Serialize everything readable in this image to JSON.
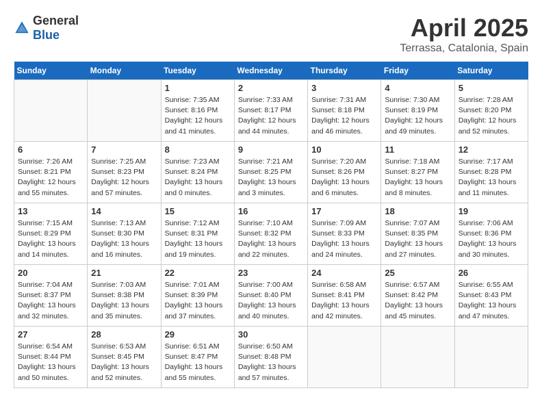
{
  "logo": {
    "general": "General",
    "blue": "Blue"
  },
  "header": {
    "month": "April 2025",
    "location": "Terrassa, Catalonia, Spain"
  },
  "weekdays": [
    "Sunday",
    "Monday",
    "Tuesday",
    "Wednesday",
    "Thursday",
    "Friday",
    "Saturday"
  ],
  "weeks": [
    [
      {
        "day": "",
        "info": ""
      },
      {
        "day": "",
        "info": ""
      },
      {
        "day": "1",
        "info": "Sunrise: 7:35 AM\nSunset: 8:16 PM\nDaylight: 12 hours\nand 41 minutes."
      },
      {
        "day": "2",
        "info": "Sunrise: 7:33 AM\nSunset: 8:17 PM\nDaylight: 12 hours\nand 44 minutes."
      },
      {
        "day": "3",
        "info": "Sunrise: 7:31 AM\nSunset: 8:18 PM\nDaylight: 12 hours\nand 46 minutes."
      },
      {
        "day": "4",
        "info": "Sunrise: 7:30 AM\nSunset: 8:19 PM\nDaylight: 12 hours\nand 49 minutes."
      },
      {
        "day": "5",
        "info": "Sunrise: 7:28 AM\nSunset: 8:20 PM\nDaylight: 12 hours\nand 52 minutes."
      }
    ],
    [
      {
        "day": "6",
        "info": "Sunrise: 7:26 AM\nSunset: 8:21 PM\nDaylight: 12 hours\nand 55 minutes."
      },
      {
        "day": "7",
        "info": "Sunrise: 7:25 AM\nSunset: 8:23 PM\nDaylight: 12 hours\nand 57 minutes."
      },
      {
        "day": "8",
        "info": "Sunrise: 7:23 AM\nSunset: 8:24 PM\nDaylight: 13 hours\nand 0 minutes."
      },
      {
        "day": "9",
        "info": "Sunrise: 7:21 AM\nSunset: 8:25 PM\nDaylight: 13 hours\nand 3 minutes."
      },
      {
        "day": "10",
        "info": "Sunrise: 7:20 AM\nSunset: 8:26 PM\nDaylight: 13 hours\nand 6 minutes."
      },
      {
        "day": "11",
        "info": "Sunrise: 7:18 AM\nSunset: 8:27 PM\nDaylight: 13 hours\nand 8 minutes."
      },
      {
        "day": "12",
        "info": "Sunrise: 7:17 AM\nSunset: 8:28 PM\nDaylight: 13 hours\nand 11 minutes."
      }
    ],
    [
      {
        "day": "13",
        "info": "Sunrise: 7:15 AM\nSunset: 8:29 PM\nDaylight: 13 hours\nand 14 minutes."
      },
      {
        "day": "14",
        "info": "Sunrise: 7:13 AM\nSunset: 8:30 PM\nDaylight: 13 hours\nand 16 minutes."
      },
      {
        "day": "15",
        "info": "Sunrise: 7:12 AM\nSunset: 8:31 PM\nDaylight: 13 hours\nand 19 minutes."
      },
      {
        "day": "16",
        "info": "Sunrise: 7:10 AM\nSunset: 8:32 PM\nDaylight: 13 hours\nand 22 minutes."
      },
      {
        "day": "17",
        "info": "Sunrise: 7:09 AM\nSunset: 8:33 PM\nDaylight: 13 hours\nand 24 minutes."
      },
      {
        "day": "18",
        "info": "Sunrise: 7:07 AM\nSunset: 8:35 PM\nDaylight: 13 hours\nand 27 minutes."
      },
      {
        "day": "19",
        "info": "Sunrise: 7:06 AM\nSunset: 8:36 PM\nDaylight: 13 hours\nand 30 minutes."
      }
    ],
    [
      {
        "day": "20",
        "info": "Sunrise: 7:04 AM\nSunset: 8:37 PM\nDaylight: 13 hours\nand 32 minutes."
      },
      {
        "day": "21",
        "info": "Sunrise: 7:03 AM\nSunset: 8:38 PM\nDaylight: 13 hours\nand 35 minutes."
      },
      {
        "day": "22",
        "info": "Sunrise: 7:01 AM\nSunset: 8:39 PM\nDaylight: 13 hours\nand 37 minutes."
      },
      {
        "day": "23",
        "info": "Sunrise: 7:00 AM\nSunset: 8:40 PM\nDaylight: 13 hours\nand 40 minutes."
      },
      {
        "day": "24",
        "info": "Sunrise: 6:58 AM\nSunset: 8:41 PM\nDaylight: 13 hours\nand 42 minutes."
      },
      {
        "day": "25",
        "info": "Sunrise: 6:57 AM\nSunset: 8:42 PM\nDaylight: 13 hours\nand 45 minutes."
      },
      {
        "day": "26",
        "info": "Sunrise: 6:55 AM\nSunset: 8:43 PM\nDaylight: 13 hours\nand 47 minutes."
      }
    ],
    [
      {
        "day": "27",
        "info": "Sunrise: 6:54 AM\nSunset: 8:44 PM\nDaylight: 13 hours\nand 50 minutes."
      },
      {
        "day": "28",
        "info": "Sunrise: 6:53 AM\nSunset: 8:45 PM\nDaylight: 13 hours\nand 52 minutes."
      },
      {
        "day": "29",
        "info": "Sunrise: 6:51 AM\nSunset: 8:47 PM\nDaylight: 13 hours\nand 55 minutes."
      },
      {
        "day": "30",
        "info": "Sunrise: 6:50 AM\nSunset: 8:48 PM\nDaylight: 13 hours\nand 57 minutes."
      },
      {
        "day": "",
        "info": ""
      },
      {
        "day": "",
        "info": ""
      },
      {
        "day": "",
        "info": ""
      }
    ]
  ]
}
